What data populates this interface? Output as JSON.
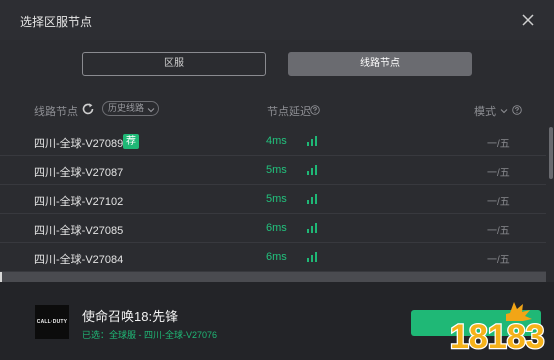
{
  "window": {
    "title": "选择区服节点",
    "close_icon": "close-icon"
  },
  "tabs": [
    {
      "label": "区服",
      "active": false
    },
    {
      "label": "线路节点",
      "active": true
    }
  ],
  "columns": {
    "node": "线路节点",
    "history": "历史线路",
    "latency": "节点延迟",
    "mode": "模式"
  },
  "rows": [
    {
      "name": "四川-全球-V27089",
      "badge": "荐",
      "latency": "4ms",
      "mode": "一/五"
    },
    {
      "name": "四川-全球-V27087",
      "badge": "",
      "latency": "5ms",
      "mode": "一/五"
    },
    {
      "name": "四川-全球-V27102",
      "badge": "",
      "latency": "5ms",
      "mode": "一/五"
    },
    {
      "name": "四川-全球-V27085",
      "badge": "",
      "latency": "6ms",
      "mode": "一/五"
    },
    {
      "name": "四川-全球-V27084",
      "badge": "",
      "latency": "6ms",
      "mode": "一/五"
    }
  ],
  "footer": {
    "game_logo_text": "CALL·DUTY",
    "game_title": "使命召唤18:先锋",
    "selected": "已选：全球服 - 四川-全球-V27076"
  },
  "watermark": {
    "text": "18183"
  },
  "colors": {
    "accent": "#1fb876",
    "background": "#2b2c30",
    "footer": "#232428"
  }
}
